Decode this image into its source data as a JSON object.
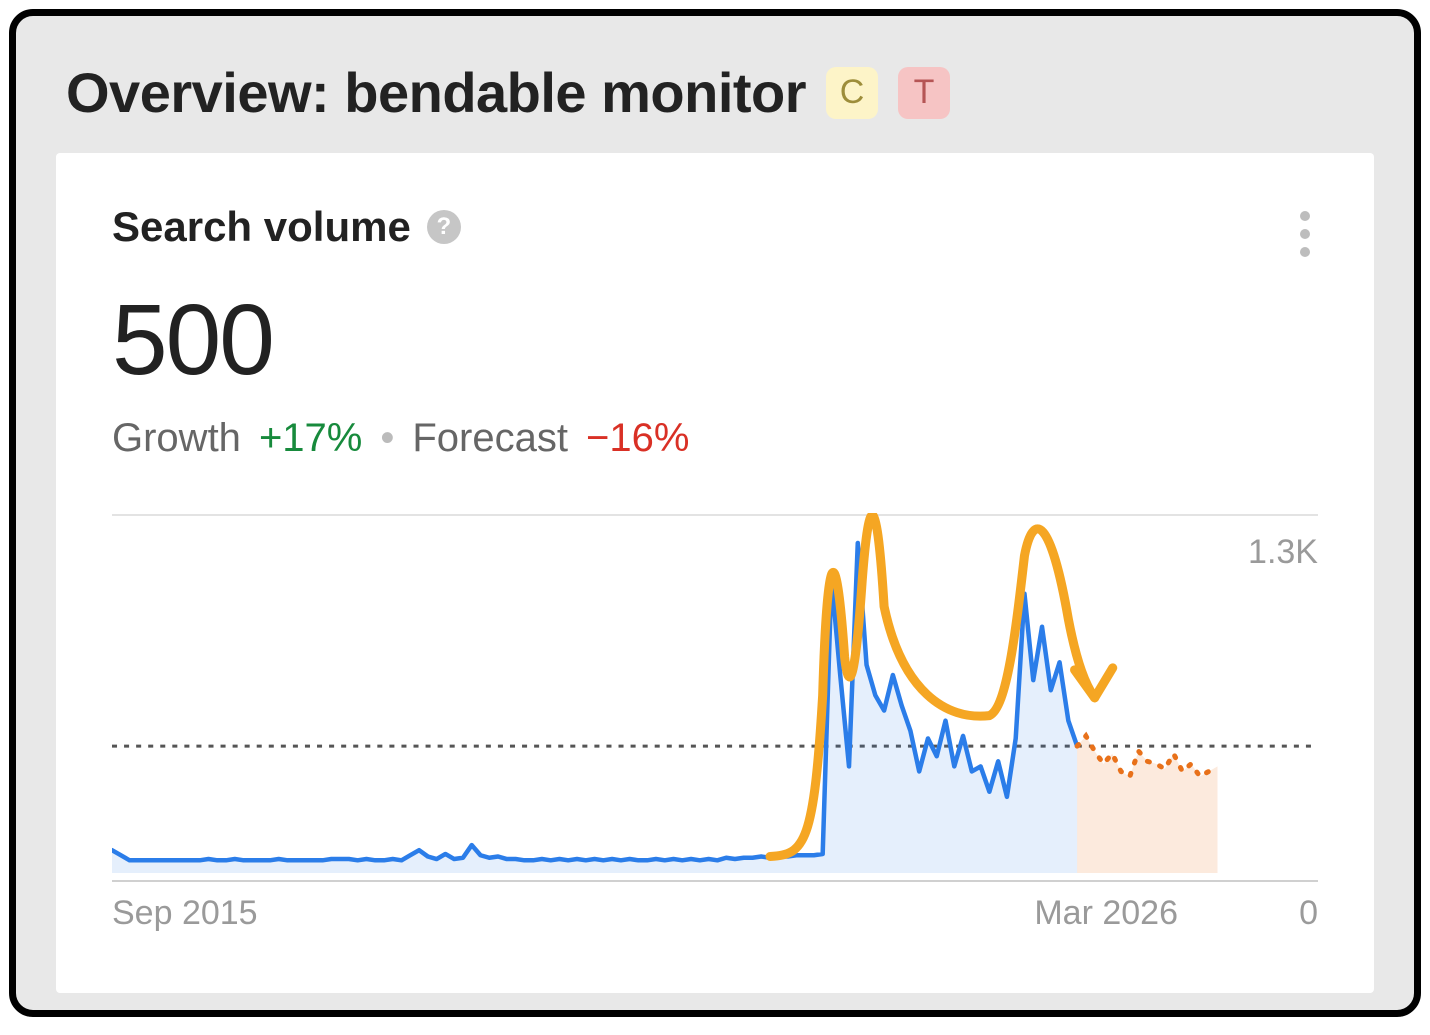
{
  "header": {
    "title": "Overview: bendable monitor",
    "badges": [
      "C",
      "T"
    ]
  },
  "card": {
    "metric_label": "Search volume",
    "metric_value": "500",
    "growth_label": "Growth",
    "growth_value": "+17%",
    "forecast_label": "Forecast",
    "forecast_value": "−16%",
    "axis": {
      "x_start": "Sep 2015",
      "x_end": "Mar 2026",
      "y_max": "1.3K",
      "y_min": "0"
    }
  },
  "chart_data": {
    "type": "line",
    "title": "Search volume",
    "xlabel": "",
    "ylabel": "",
    "ylim": [
      0,
      1300
    ],
    "reference_line": 500,
    "x_range_labels": [
      "Sep 2015",
      "Mar 2026"
    ],
    "x": [
      0,
      1,
      2,
      3,
      4,
      5,
      6,
      7,
      8,
      9,
      10,
      11,
      12,
      13,
      14,
      15,
      16,
      17,
      18,
      19,
      20,
      21,
      22,
      23,
      24,
      25,
      26,
      27,
      28,
      29,
      30,
      31,
      32,
      33,
      34,
      35,
      36,
      37,
      38,
      39,
      40,
      41,
      42,
      43,
      44,
      45,
      46,
      47,
      48,
      49,
      50,
      51,
      52,
      53,
      54,
      55,
      56,
      57,
      58,
      59,
      60,
      61,
      62,
      63,
      64,
      65,
      66,
      67,
      68,
      69,
      70,
      71,
      72,
      73,
      74,
      75,
      76,
      77,
      78,
      79,
      80,
      81,
      82,
      83,
      84,
      85,
      86,
      87,
      88,
      89,
      90,
      91,
      92,
      93,
      94,
      95,
      96,
      97,
      98,
      99,
      100,
      101,
      102,
      103,
      104,
      105,
      106,
      107,
      108,
      109,
      110,
      111,
      112,
      113,
      114,
      115,
      116,
      117,
      118,
      119,
      120,
      121,
      122,
      123,
      124,
      125,
      126
    ],
    "series": [
      {
        "name": "Search volume (actual)",
        "color": "#2b7de9",
        "values": [
          90,
          70,
          50,
          50,
          50,
          50,
          50,
          50,
          50,
          50,
          50,
          55,
          50,
          50,
          55,
          50,
          50,
          50,
          50,
          55,
          50,
          50,
          50,
          50,
          50,
          55,
          55,
          55,
          50,
          55,
          50,
          50,
          55,
          50,
          70,
          90,
          65,
          55,
          75,
          55,
          60,
          110,
          70,
          60,
          65,
          55,
          55,
          50,
          50,
          55,
          50,
          55,
          50,
          55,
          50,
          55,
          50,
          55,
          50,
          55,
          50,
          50,
          55,
          50,
          55,
          50,
          55,
          50,
          55,
          50,
          60,
          55,
          60,
          60,
          65,
          60,
          65,
          65,
          70,
          70,
          70,
          75,
          1160,
          780,
          420,
          1300,
          820,
          700,
          640,
          780,
          660,
          560,
          400,
          530,
          460,
          600,
          420,
          540,
          400,
          420,
          320,
          440,
          300,
          530,
          1100,
          760,
          970,
          720,
          830,
          600,
          500
        ],
        "x_end_index": 110
      },
      {
        "name": "Search volume (forecast)",
        "color": "#e8711a",
        "dashed": true,
        "x_start_index": 110,
        "values": [
          500,
          540,
          480,
          430,
          470,
          400,
          380,
          480,
          440,
          430,
          410,
          470,
          400,
          430,
          380,
          400,
          420
        ]
      }
    ],
    "annotation": {
      "type": "freehand-arrow",
      "color": "#f5a623",
      "description": "Hand-drawn curve following the two historical peaks and the rising third peak, ending with a downward arrowhead into the forecast region"
    }
  }
}
